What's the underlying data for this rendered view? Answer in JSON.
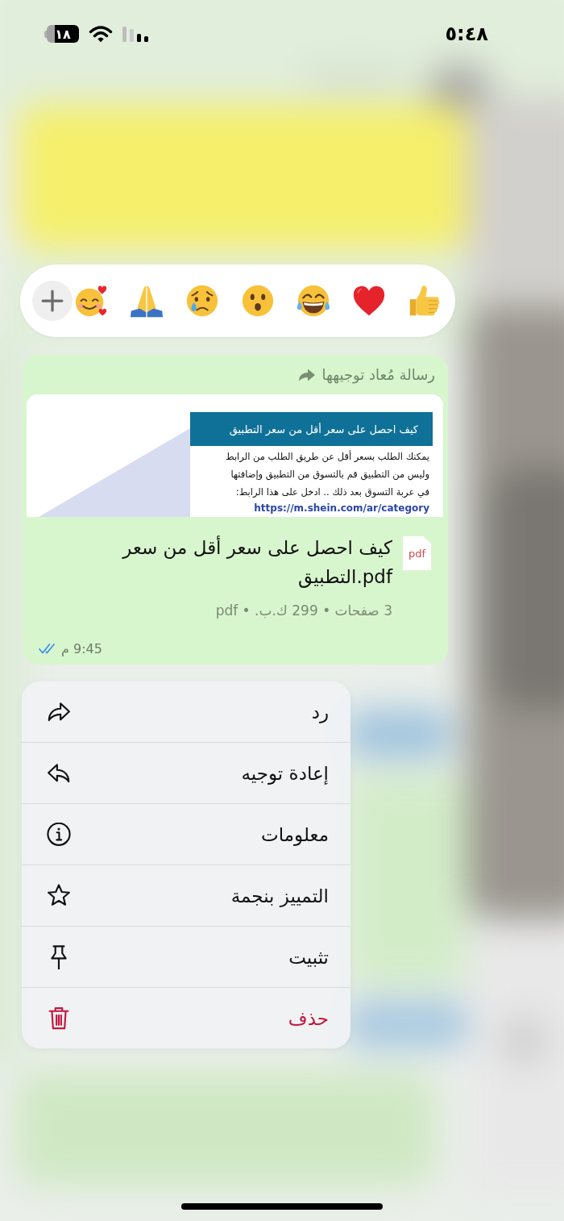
{
  "status_bar": {
    "time": "٥:٤٨",
    "battery": "١٨"
  },
  "reactions": [
    {
      "kind": "thumbs-up"
    },
    {
      "kind": "red-heart"
    },
    {
      "kind": "tears-of-joy"
    },
    {
      "kind": "surprised"
    },
    {
      "kind": "crying"
    },
    {
      "kind": "folded-hands"
    },
    {
      "kind": "smiling-hearts"
    },
    {
      "kind": "add"
    }
  ],
  "message": {
    "forwarded_label": "رسالة مُعاد توجيهها",
    "preview": {
      "heading": "كيف احصل على سعر أقل من سعر التطبيق",
      "lines": [
        "يمكنك الطلب بسعر أقل عن طريق الطلب من الرابط",
        "وليس من التطبيق قم بالتسوق من التطبيق وإضافتها",
        "في عربة التسوق بعد ذلك .. ادخل على هذا الرابط:"
      ],
      "link": "https://m.shein.com/ar/category"
    },
    "file": {
      "type_label": "pdf",
      "name": "كيف احصل على سعر أقل من سعر التطبيق.pdf",
      "details": "3 صفحات • 299 ك.ب. • pdf"
    },
    "time": "9:45 م",
    "read": true
  },
  "menu": {
    "items": [
      {
        "kind": "reply",
        "label": "رد",
        "destructive": false
      },
      {
        "kind": "forward",
        "label": "إعادة توجيه",
        "destructive": false
      },
      {
        "kind": "info",
        "label": "معلومات",
        "destructive": false
      },
      {
        "kind": "star",
        "label": "التمييز بنجمة",
        "destructive": false
      },
      {
        "kind": "pin",
        "label": "تثبيت",
        "destructive": false
      },
      {
        "kind": "delete",
        "label": "حذف",
        "destructive": true
      }
    ]
  }
}
